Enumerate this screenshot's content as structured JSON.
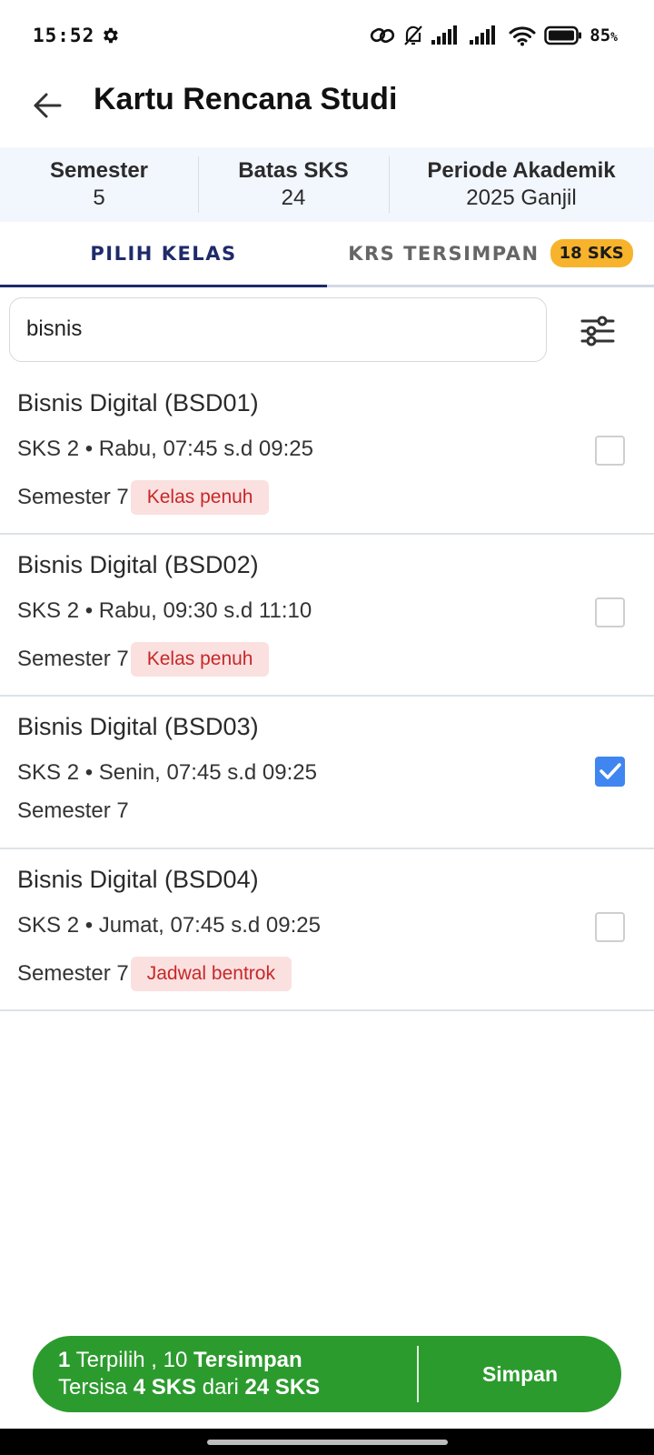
{
  "status_bar": {
    "time": "15:52",
    "battery_percent": "85",
    "battery_suffix": "%",
    "icons": [
      "gear-icon",
      "link-icon",
      "bell-off-icon",
      "signal-icon",
      "signal-icon",
      "wifi-icon",
      "battery-icon"
    ]
  },
  "app_bar": {
    "back_icon": "arrow-left-icon",
    "title": "Kartu Rencana Studi"
  },
  "info": {
    "semester_label": "Semester",
    "semester_value": "5",
    "batas_label": "Batas SKS",
    "batas_value": "24",
    "periode_label": "Periode Akademik",
    "periode_value": "2025 Ganjil"
  },
  "tabs": {
    "pilih_kelas": "PILIH KELAS",
    "krs_tersimpan": "KRS TERSIMPAN",
    "krs_badge": "18 SKS",
    "active": "pilih_kelas"
  },
  "search": {
    "value": "bisnis",
    "filter_icon": "sliders-icon"
  },
  "courses": [
    {
      "title": "Bisnis Digital (BSD01)",
      "meta": "SKS 2 • Rabu, 07:45 s.d 09:25",
      "semester": "Semester 7",
      "status": "Kelas penuh",
      "checked": false
    },
    {
      "title": "Bisnis Digital (BSD02)",
      "meta": "SKS 2 • Rabu, 09:30 s.d 11:10",
      "semester": "Semester 7",
      "status": "Kelas penuh",
      "checked": false
    },
    {
      "title": "Bisnis Digital (BSD03)",
      "meta": "SKS 2 • Senin, 07:45 s.d 09:25",
      "semester": "Semester 7",
      "status": "",
      "checked": true
    },
    {
      "title": "Bisnis Digital (BSD04)",
      "meta": "SKS 2 • Jumat, 07:45 s.d 09:25",
      "semester": "Semester 7",
      "status": "Jadwal bentrok",
      "checked": false
    }
  ],
  "summary": {
    "selected_count": "1",
    "selected_label": "Terpilih ,",
    "saved_count": "10",
    "saved_label": "Tersimpan",
    "remaining_prefix": "Tersisa",
    "remaining_sks": "4 SKS",
    "remaining_mid": "dari",
    "total_sks": "24 SKS",
    "save_button": "Simpan"
  },
  "colors": {
    "primary_navy": "#1e2a6a",
    "badge_amber": "#f7b32b",
    "checkbox_blue": "#3f86f0",
    "chip_red_text": "#c62828",
    "chip_red_bg": "#fbe0e0",
    "bottom_bar_green": "#2c9b2e",
    "info_strip_bg": "#f2f6fd"
  }
}
